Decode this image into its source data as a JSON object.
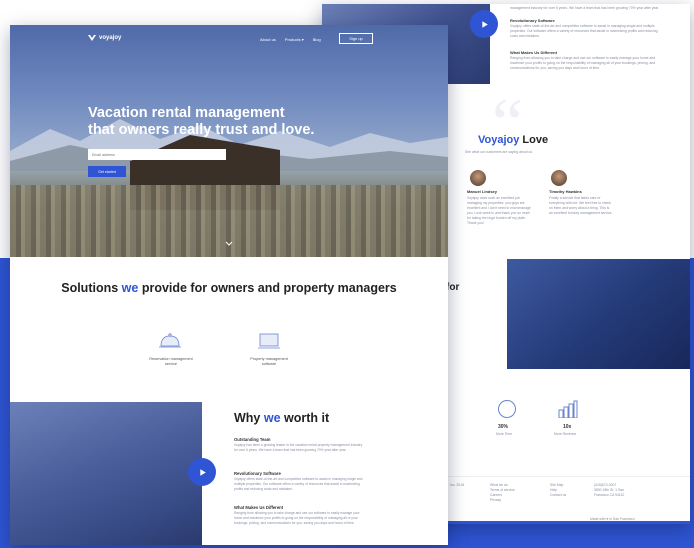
{
  "brand": {
    "name": "voyajoy",
    "accent": "#2f55d4"
  },
  "nav": {
    "links": [
      "About us",
      "Products ▾",
      "Blog"
    ],
    "signup": "Sign up"
  },
  "hero": {
    "headline_line1": "Vacation rental management",
    "headline_line2": "that owners really trust and love.",
    "email_placeholder": "Email address",
    "cta": "Get started"
  },
  "solutions": {
    "title_pre": "Solutions ",
    "title_em": "we",
    "title_post": " provide for owners and property managers",
    "features": [
      {
        "label_line1": "Reservation management",
        "label_line2": "service",
        "icon": "cloche-icon"
      },
      {
        "label_line1": "Property management",
        "label_line2": "software",
        "icon": "laptop-icon"
      }
    ]
  },
  "why": {
    "title_pre": "Why ",
    "title_em": "we",
    "title_post": " worth it",
    "items": [
      {
        "heading": "Outstanding Team",
        "body": "Voyajoy has been a growing leader in the vacation rental property management industry for over 6 years. We have a team that has been growing 70% year after year."
      },
      {
        "heading": "Revolutionary Software",
        "body": "Voyajoy offers state-of-the-art and competitive software to assist in managing single and multiple properties. Our software offers a variety of resources that assist in maximizing profits and reducing costs and mistakes."
      },
      {
        "heading": "What Makes Us Different",
        "body": "Ranging from allowing you to take charge and use our software to easily manage your home and maximize your profits to going on the responsibility of managing all of your bookings, pricing, and communications for you, saving you days and hours of time."
      }
    ]
  },
  "back": {
    "top_text": "management industry for over 6 years. We have a team that has been growing 70% year after year.",
    "top_items": [
      {
        "heading": "Revolutionary Software",
        "body": "Voyajoy offers state-of-the-art and competitive software to assist in managing single and multiple properties. Our software offers a variety of resources that assist in maximizing profits and reducing costs and mistakes."
      },
      {
        "heading": "What Makes Us Different",
        "body": "Ranging from allowing you to take charge and use our software to easily manage your home and maximize your profits to going on the responsibility of managing all of your bookings, pricing, and communications for you, saving you days and hours of time."
      }
    ],
    "love_title_em": "Voyajoy",
    "love_title_post": " Love",
    "love_sub": "See what our customers are saying about us",
    "testimonials": [
      {
        "name": "Manuel Lindsey",
        "text": "Voyajoy does such an excellent job managing my properties. you guys are excellent and I don't need to micromanage you. Look week in and thank you so much for taking the huge burden off my plate. Thank you!"
      },
      {
        "name": "Timothy Hawkins",
        "text": "Finally a service that takes care of everything with me. We feel free to check on them and worry about a thing. This is an excellent turnkey management service."
      }
    ],
    "for_label": "for",
    "stats": [
      {
        "value": "30%",
        "label": "More Time",
        "icon": "clock-icon"
      },
      {
        "value": "10x",
        "label": "More Revenue",
        "icon": "bar-chart-icon"
      }
    ],
    "footer_cols": [
      [
        "What we do",
        "Terms of service",
        "Careers",
        "Privacy"
      ],
      [
        "Site Map",
        "Help",
        "Contact us"
      ],
      [
        "(415)673-0007",
        "3800 18th St. 1 San",
        "Francisco CA 94110"
      ]
    ],
    "footer_left": "Inc. 2018",
    "footer_bottom": "Made with ♥ in San Francisco"
  }
}
